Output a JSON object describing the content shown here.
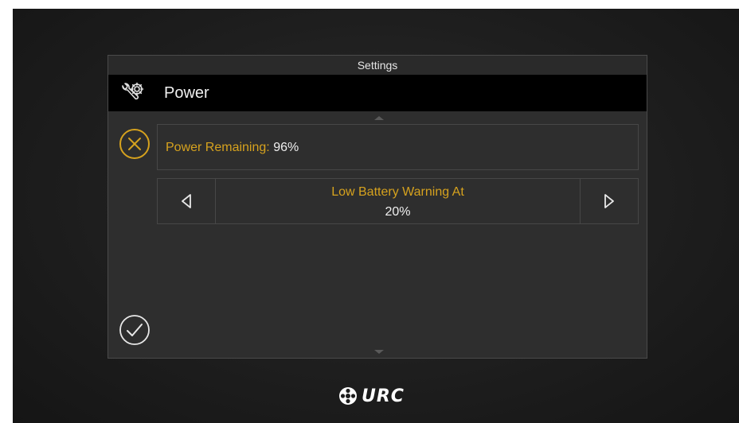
{
  "panel": {
    "title": "Settings",
    "header": {
      "label": "Power",
      "icon": "tools-gear-icon"
    }
  },
  "power": {
    "label": "Power Remaining:",
    "value": "96%"
  },
  "low_battery": {
    "label": "Low Battery Warning At",
    "value": "20%"
  },
  "buttons": {
    "cancel_icon": "close-circle-icon",
    "ok_icon": "check-circle-icon"
  },
  "logo": {
    "text": "URC",
    "icon": "urc-reel-icon"
  },
  "colors": {
    "accent": "#d6a21e",
    "text": "#f0f0f0",
    "background": "#1e1e1e",
    "panel": "#2e2e2e",
    "header": "#000000"
  }
}
